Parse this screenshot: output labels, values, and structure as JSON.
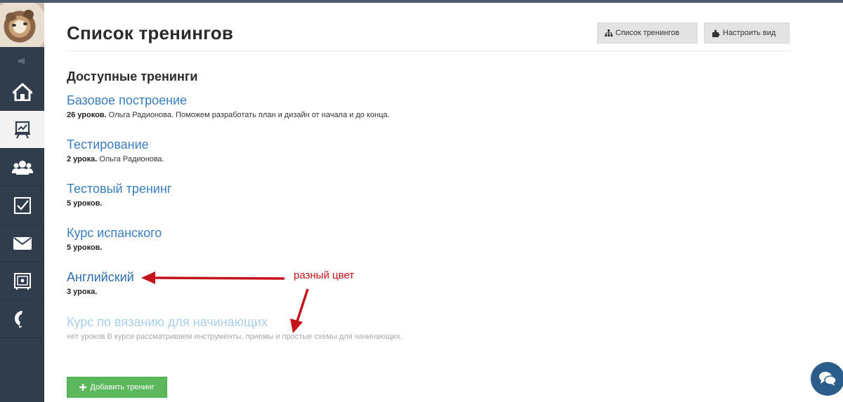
{
  "header": {
    "title": "Список тренингов",
    "buttons": [
      {
        "label": "Список тренингов",
        "icon": "sitemap-icon"
      },
      {
        "label": "Настроить вид",
        "icon": "puzzle-icon"
      }
    ]
  },
  "sidebar": {
    "items": [
      {
        "icon": "home-icon"
      },
      {
        "icon": "training-board-icon",
        "active": true
      },
      {
        "icon": "users-icon"
      },
      {
        "icon": "checkbox-icon"
      },
      {
        "icon": "envelope-icon"
      },
      {
        "icon": "safe-icon"
      },
      {
        "icon": "chat-c-icon"
      }
    ]
  },
  "main": {
    "section_title": "Доступные тренинги",
    "trainings": [
      {
        "name": "Базовое построение",
        "count": "26 уроков.",
        "description": "Ольга Радионова. Поможем разработать план и дизайн от начала и до конца."
      },
      {
        "name": "Тестирование",
        "count": "2 урока.",
        "description": "Ольга Радионова."
      },
      {
        "name": "Тестовый тренинг",
        "count": "5 уроков.",
        "description": ""
      },
      {
        "name": "Курс испанского",
        "count": "5 уроков.",
        "description": ""
      },
      {
        "name": "Английский",
        "count": "3 урока.",
        "description": ""
      },
      {
        "name": "Курс по вязанию для начинающих",
        "count": "нет уроков",
        "description": "В курсе рассматриваем инструменты, приемы и простые схемы для начинающих."
      }
    ],
    "annotation": "разный цвет",
    "add_button": "Добавить тренинг"
  },
  "colors": {
    "sidebar": "#2f3d4c",
    "link": "#3a7ebf",
    "link_disabled": "#a9cfe8",
    "annotation": "#c4131a",
    "add_button": "#5cb85c"
  }
}
